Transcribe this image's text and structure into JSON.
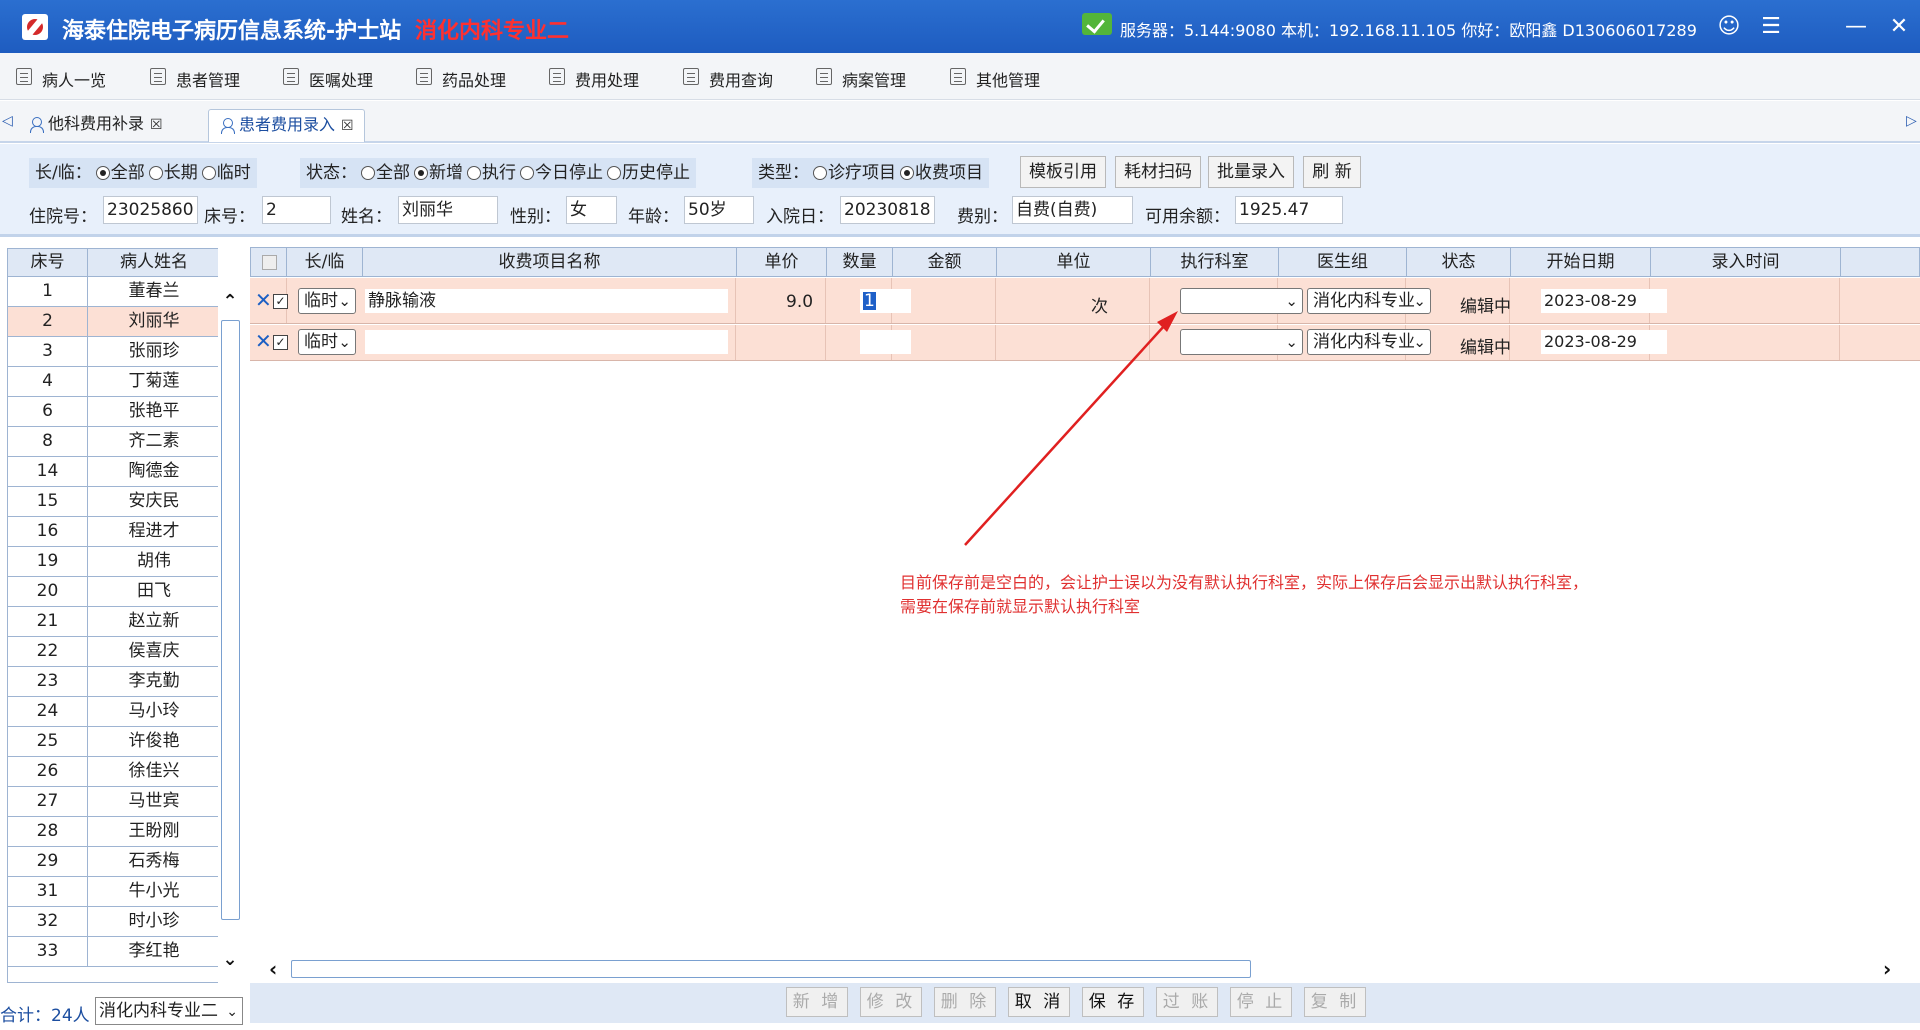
{
  "titlebar": {
    "app_title": "海泰住院电子病历信息系统-护士站",
    "dept_title": "消化内科专业二",
    "server_info": "服务器：5.144:9080 本机：192.168.11.105 你好：欧阳鑫 D130606017289"
  },
  "menu": [
    "病人一览",
    "患者管理",
    "医嘱处理",
    "药品处理",
    "费用处理",
    "费用查询",
    "病案管理",
    "其他管理"
  ],
  "tabs": [
    {
      "label": "他科费用补录"
    },
    {
      "label": "患者费用录入"
    }
  ],
  "filters": {
    "long_temp_label": "长/临：",
    "long_temp_options": [
      "全部",
      "长期",
      "临时"
    ],
    "status_label": "状态：",
    "status_options": [
      "全部",
      "新增",
      "执行",
      "今日停止",
      "历史停止"
    ],
    "type_label": "类型：",
    "type_options": [
      "诊疗项目",
      "收费项目"
    ],
    "buttons": [
      "模板引用",
      "耗材扫码",
      "批量录入",
      "刷 新"
    ]
  },
  "patient": {
    "admission_no_label": "住院号：",
    "admission_no": "23025860",
    "bed_label": "床号：",
    "bed": "2",
    "name_label": "姓名：",
    "name": "刘丽华",
    "sex_label": "性别：",
    "sex": "女",
    "age_label": "年龄：",
    "age": "50岁",
    "admit_date_label": "入院日：",
    "admit_date": "20230818",
    "fee_type_label": "费别：",
    "fee_type": "自费(自费)",
    "balance_label": "可用余额：",
    "balance": "1925.47"
  },
  "patient_list": {
    "headers": [
      "床号",
      "病人姓名"
    ],
    "rows": [
      {
        "bed": "1",
        "name": "董春兰"
      },
      {
        "bed": "2",
        "name": "刘丽华"
      },
      {
        "bed": "3",
        "name": "张丽珍"
      },
      {
        "bed": "4",
        "name": "丁菊莲"
      },
      {
        "bed": "6",
        "name": "张艳平"
      },
      {
        "bed": "8",
        "name": "齐二素"
      },
      {
        "bed": "14",
        "name": "陶德金"
      },
      {
        "bed": "15",
        "name": "安庆民"
      },
      {
        "bed": "16",
        "name": "程进才"
      },
      {
        "bed": "19",
        "name": "胡伟"
      },
      {
        "bed": "20",
        "name": "田飞"
      },
      {
        "bed": "21",
        "name": "赵立新"
      },
      {
        "bed": "22",
        "name": "侯喜庆"
      },
      {
        "bed": "23",
        "name": "李克勤"
      },
      {
        "bed": "24",
        "name": "马小玲"
      },
      {
        "bed": "25",
        "name": "许俊艳"
      },
      {
        "bed": "26",
        "name": "徐佳兴"
      },
      {
        "bed": "27",
        "name": "马世宾"
      },
      {
        "bed": "28",
        "name": "王盼刚"
      },
      {
        "bed": "29",
        "name": "石秀梅"
      },
      {
        "bed": "31",
        "name": "牛小光"
      },
      {
        "bed": "32",
        "name": "时小珍"
      },
      {
        "bed": "33",
        "name": "李红艳"
      }
    ],
    "total": "合计：24人",
    "dept_select": "消化内科专业二"
  },
  "grid": {
    "headers": [
      "长/临",
      "收费项目名称",
      "单价",
      "数量",
      "金额",
      "单位",
      "执行科室",
      "医生组",
      "状态",
      "开始日期",
      "录入时间"
    ],
    "rows": [
      {
        "long_temp": "临时",
        "item_name": "静脉输液",
        "price": "9.0",
        "qty": "1",
        "amount": "",
        "unit": "次",
        "exec_dept": "",
        "doctor_group": "消化内科专业",
        "status": "编辑中",
        "start_date": "2023-08-29"
      },
      {
        "long_temp": "临时",
        "item_name": "",
        "price": "",
        "qty": "",
        "amount": "",
        "unit": "",
        "exec_dept": "",
        "doctor_group": "消化内科专业",
        "status": "编辑中",
        "start_date": "2023-08-29"
      }
    ]
  },
  "actions": [
    "新 增",
    "修 改",
    "删 除",
    "取 消",
    "保 存",
    "过 账",
    "停 止",
    "复 制"
  ],
  "annotation": {
    "line1": "目前保存前是空白的，会让护士误以为没有默认执行科室，实际上保存后会显示出默认执行科室，",
    "line2": "需要在保存前就显示默认执行科室"
  }
}
